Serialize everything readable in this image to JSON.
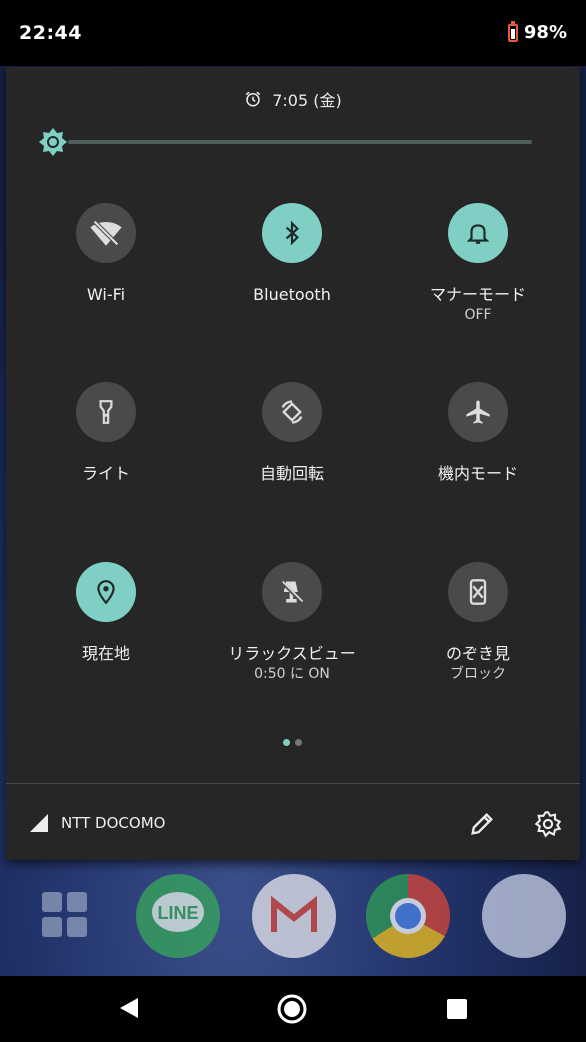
{
  "status": {
    "time": "22:44",
    "battery": "98%"
  },
  "alarm": {
    "text": "7:05 (金)"
  },
  "brightness": {
    "level": 0.0
  },
  "tiles": [
    {
      "label": "Wi-Fi",
      "sub": "",
      "icon": "wifi-off-icon",
      "on": false
    },
    {
      "label": "Bluetooth",
      "sub": "",
      "icon": "bluetooth-icon",
      "on": true
    },
    {
      "label": "マナーモード",
      "sub": "OFF",
      "icon": "bell-icon",
      "on": true
    },
    {
      "label": "ライト",
      "sub": "",
      "icon": "flashlight-icon",
      "on": false
    },
    {
      "label": "自動回転",
      "sub": "",
      "icon": "auto-rotate-icon",
      "on": false
    },
    {
      "label": "機内モード",
      "sub": "",
      "icon": "airplane-icon",
      "on": false
    },
    {
      "label": "現在地",
      "sub": "",
      "icon": "location-pin-icon",
      "on": true
    },
    {
      "label": "リラックスビュー",
      "sub": "0:50 に ON",
      "icon": "night-light-off-icon",
      "on": false
    },
    {
      "label": "のぞき見",
      "sub": "ブロック",
      "icon": "privacy-block-icon",
      "on": false
    }
  ],
  "footer": {
    "carrier": "NTT DOCOMO"
  },
  "dock": {
    "line_label": "LINE"
  },
  "colors": {
    "accent": "#7fcfc4",
    "panel": "#262626",
    "tile_off": "#4a4a4a"
  }
}
